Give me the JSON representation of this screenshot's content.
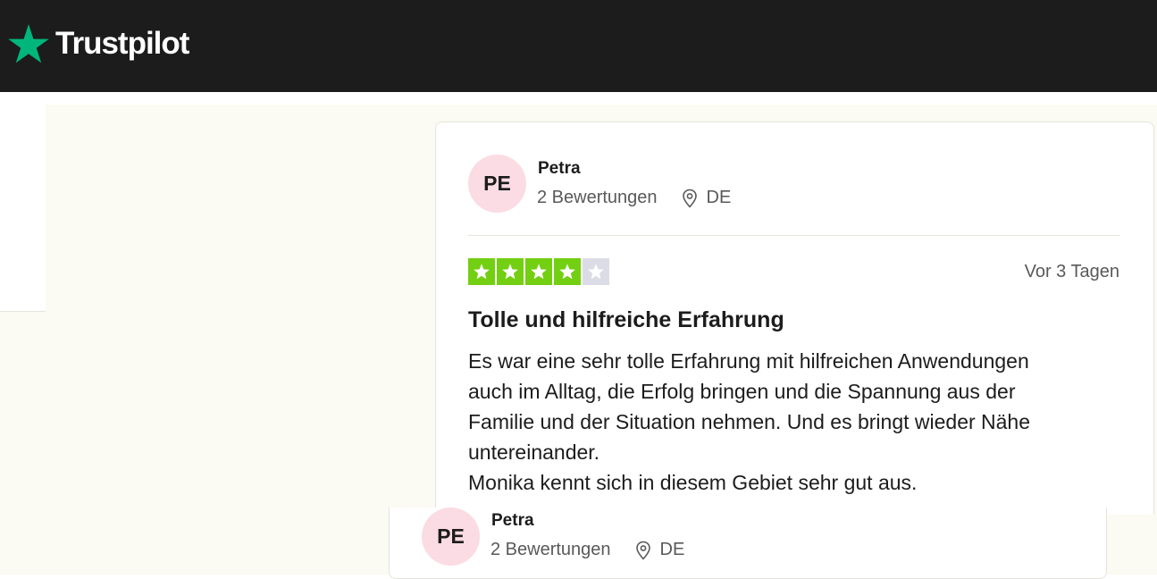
{
  "header": {
    "brand": "Trustpilot",
    "logo_icon": "star-icon",
    "brand_color": "#00b67a"
  },
  "reviews": [
    {
      "initials": "PE",
      "name": "Petra",
      "review_count": "2 Bewertungen",
      "country": "DE",
      "rating": 4,
      "rating_max": 5,
      "date": "Vor 3 Tagen",
      "title": "Tolle und hilfreiche Erfahrung",
      "body": "Es war eine sehr tolle Erfahrung mit hilfreichen Anwendungen\nauch im Alltag, die Erfolg bringen und die Spannung aus der\nFamilie und der Situation nehmen. Und es bringt wieder Nähe\nuntereinander.\nMonika kennt sich in diesem Gebiet sehr gut aus."
    },
    {
      "initials": "PE",
      "name": "Petra",
      "review_count": "2 Bewertungen",
      "country": "DE"
    }
  ],
  "colors": {
    "star_on": "#73cf11",
    "star_off": "#dcdce6",
    "avatar_bg": "#fbdbe4",
    "page_bg": "#fbfaf3"
  }
}
